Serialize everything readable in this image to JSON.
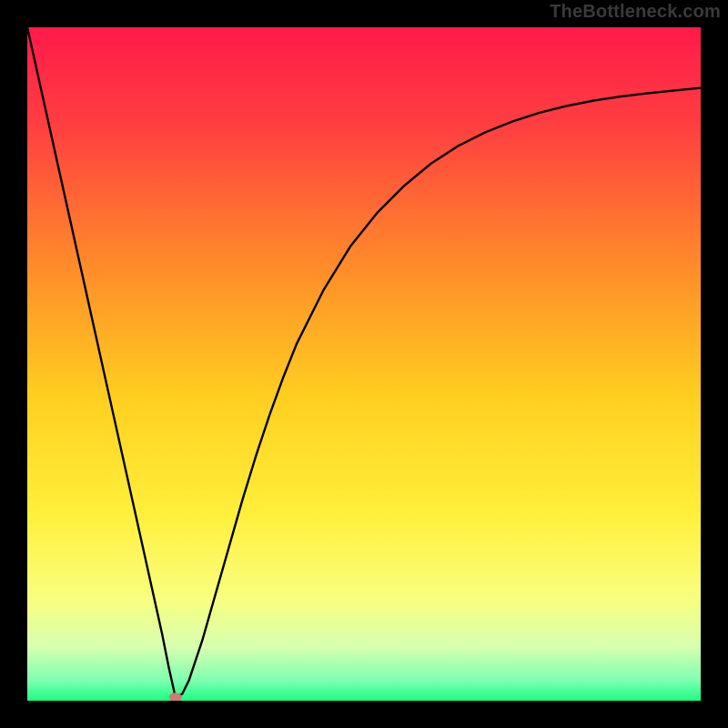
{
  "attribution": "TheBottleneck.com",
  "chart_data": {
    "type": "line",
    "title": "",
    "xlabel": "",
    "ylabel": "",
    "xlim": [
      0,
      100
    ],
    "ylim": [
      0,
      100
    ],
    "series": [
      {
        "name": "bottleneck-curve",
        "x": [
          0,
          2,
          4,
          6,
          8,
          10,
          12,
          14,
          16,
          18,
          20,
          21,
          22,
          23,
          24,
          26,
          28,
          30,
          32,
          34,
          36,
          38,
          40,
          44,
          48,
          52,
          56,
          60,
          64,
          68,
          72,
          76,
          80,
          84,
          88,
          92,
          96,
          100
        ],
        "y": [
          100,
          91,
          82,
          73,
          64,
          55,
          46,
          37,
          28,
          19,
          10,
          5,
          0.5,
          1,
          3,
          9,
          16,
          23,
          30,
          36.5,
          42.5,
          48,
          53,
          61,
          67.5,
          72.5,
          76.5,
          79.8,
          82.4,
          84.4,
          86,
          87.3,
          88.3,
          89.1,
          89.7,
          90.2,
          90.6,
          91
        ]
      }
    ],
    "marker": {
      "x_pct": 22,
      "y_pct": 0.5,
      "color": "#cf7a74"
    },
    "gradient_stops": [
      {
        "pct": 0,
        "color": "#ff1a4b"
      },
      {
        "pct": 15,
        "color": "#ff4040"
      },
      {
        "pct": 35,
        "color": "#ff8a2a"
      },
      {
        "pct": 55,
        "color": "#ffcf20"
      },
      {
        "pct": 72,
        "color": "#ffef3a"
      },
      {
        "pct": 85,
        "color": "#f8ff80"
      },
      {
        "pct": 92,
        "color": "#d8ffb0"
      },
      {
        "pct": 97,
        "color": "#7dffb0"
      },
      {
        "pct": 100,
        "color": "#1aff84"
      }
    ]
  }
}
